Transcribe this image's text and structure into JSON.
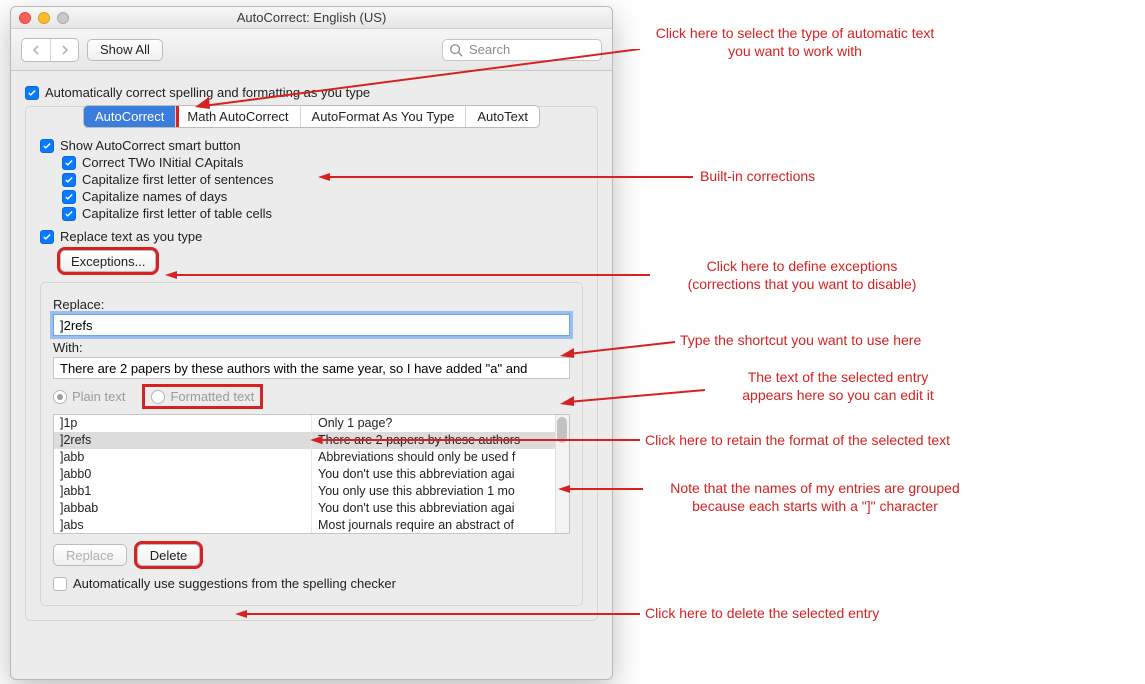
{
  "window": {
    "title": "AutoCorrect: English (US)",
    "toolbar": {
      "show_all": "Show All",
      "search_placeholder": "Search"
    }
  },
  "main": {
    "master_checkbox": "Automatically correct spelling and formatting as you type",
    "tabs": [
      "AutoCorrect",
      "Math AutoCorrect",
      "AutoFormat As You Type",
      "AutoText"
    ],
    "smart_button": "Show AutoCorrect smart button",
    "sub_checks": [
      "Correct TWo INitial CApitals",
      "Capitalize first letter of sentences",
      "Capitalize names of days",
      "Capitalize first letter of table cells"
    ],
    "replace_cb": "Replace text as you type",
    "exceptions_btn": "Exceptions...",
    "replace_label": "Replace:",
    "replace_value": "]2refs",
    "with_label": "With:",
    "with_value": "There are 2 papers by these authors with the same year, so I have added \"a\" and",
    "radio_plain": "Plain text",
    "radio_formatted": "Formatted text",
    "table_rows": [
      {
        "k": "]1p",
        "v": "Only 1 page?"
      },
      {
        "k": "]2refs",
        "v": "There are 2 papers by these authors"
      },
      {
        "k": "]abb",
        "v": "Abbreviations should only be used f"
      },
      {
        "k": "]abb0",
        "v": "You don't use this abbreviation agai"
      },
      {
        "k": "]abb1",
        "v": "You only use this abbreviation 1 mo"
      },
      {
        "k": "]abbab",
        "v": "You don't use this abbreviation agai"
      },
      {
        "k": "]abs",
        "v": "Most journals require an abstract of"
      }
    ],
    "replace_btn": "Replace",
    "delete_btn": "Delete",
    "spellcheck_cb": "Automatically use suggestions from the spelling checker"
  },
  "annotations": {
    "a1": "Click here to select the type of automatic text you want to work with",
    "a2": "Built-in corrections",
    "a3a": "Click here to define exceptions",
    "a3b": "(corrections that you want to disable)",
    "a4": "Type the shortcut you want to use here",
    "a5a": "The text of the selected entry",
    "a5b": "appears here so you can edit it",
    "a6": "Click here to retain the format of the selected text",
    "a7a": "Note that the names of my entries are grouped",
    "a7b": "because each starts with a \"]\" character",
    "a8": "Click here to delete the selected entry"
  }
}
